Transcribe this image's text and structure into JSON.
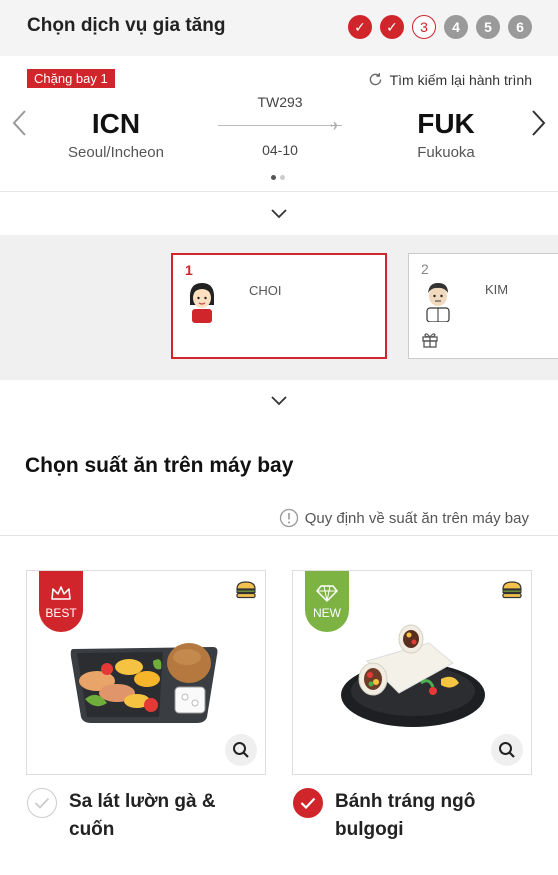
{
  "header": {
    "title": "Chọn dịch vụ gia tăng",
    "steps": [
      {
        "label": "✓",
        "state": "done"
      },
      {
        "label": "✓",
        "state": "done"
      },
      {
        "label": "3",
        "state": "current"
      },
      {
        "label": "4",
        "state": "todo"
      },
      {
        "label": "5",
        "state": "todo"
      },
      {
        "label": "6",
        "state": "todo"
      }
    ]
  },
  "flight": {
    "leg_label": "Chặng bay 1",
    "research_label": "Tìm kiếm lại hành trình",
    "from": {
      "code": "ICN",
      "city": "Seoul/Incheon"
    },
    "to": {
      "code": "FUK",
      "city": "Fukuoka"
    },
    "flight_no": "TW293",
    "date": "04-10"
  },
  "passengers": [
    {
      "num": "1",
      "name": "CHOI"
    },
    {
      "num": "2",
      "name": "KIM"
    }
  ],
  "meal": {
    "title": "Chọn suất ăn trên máy bay",
    "rule_link": "Quy định về suất ăn trên máy bay",
    "items": [
      {
        "badge": "BEST",
        "name": "Sa lát lườn gà & cuốn",
        "selected": false
      },
      {
        "badge": "NEW",
        "name": "Bánh tráng ngô bulgogi",
        "selected": true
      }
    ]
  },
  "colors": {
    "accent": "#d0252b",
    "new_badge": "#7cb342",
    "step_todo": "#9a9a9a"
  }
}
